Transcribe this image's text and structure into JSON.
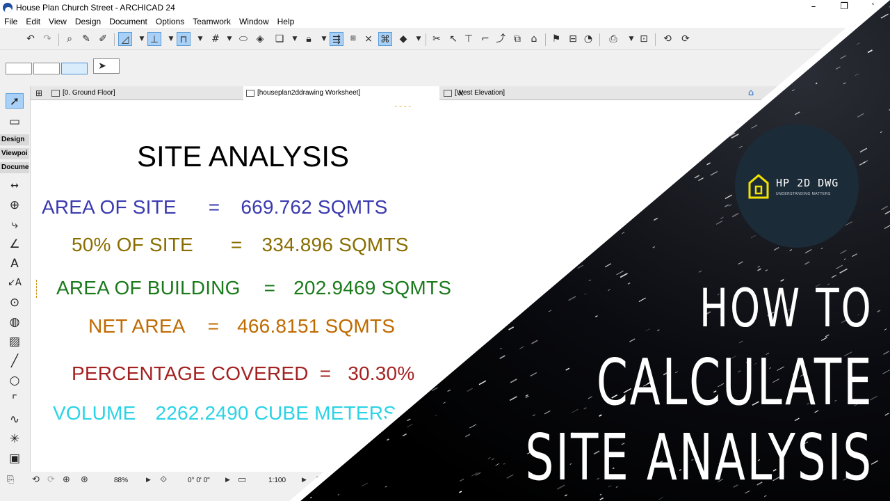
{
  "window": {
    "title": "House Plan Church Street - ARCHICAD 24",
    "minimize": "–",
    "maximize": "❐",
    "close": "✕"
  },
  "menu": [
    "File",
    "Edit",
    "View",
    "Design",
    "Document",
    "Options",
    "Teamwork",
    "Window",
    "Help"
  ],
  "tabs": [
    {
      "label": "[0. Ground Floor]"
    },
    {
      "label": "[houseplan2ddrawing Worksheet]"
    },
    {
      "label": "[West Elevation]"
    }
  ],
  "tab_close": "×",
  "toolbox": {
    "groups": [
      "Design",
      "Viewpoi",
      "Docume"
    ]
  },
  "worksheet": {
    "title": "SITE ANALYSIS",
    "dash_mark": "----",
    "lines": [
      {
        "label": "AREA OF SITE",
        "eq": "=",
        "value": "669.762 SQMTS",
        "color": "#3a3ab0"
      },
      {
        "label": "50% OF SITE",
        "eq": "=",
        "value": "334.896 SQMTS",
        "color": "#8a6d00"
      },
      {
        "label": "AREA OF BUILDING",
        "eq": "=",
        "value": "202.9469 SQMTS",
        "color": "#1b7a1b"
      },
      {
        "label": "NET AREA",
        "eq": "=",
        "value": "466.8151 SQMTS",
        "color": "#c06a00"
      },
      {
        "label": "PERCENTAGE COVERED",
        "eq": "=",
        "value": "30.30%",
        "color": "#a52121"
      },
      {
        "label": "VOLUME",
        "eq": "",
        "value": "2262.2490  CUBE METERS",
        "color": "#2bd3e6"
      }
    ]
  },
  "statusbar": {
    "zoom": "88%",
    "angle": "0° 0' 0\"",
    "scale": "1:100"
  },
  "overlay": {
    "logo_text": "HP 2D DWG",
    "logo_sub": "UNDERSTANDING MATTERS",
    "logo_color": "#f2e300",
    "line1": "HOW TO",
    "line2": "CALCULATE",
    "line3": "SITE ANALYSIS"
  }
}
